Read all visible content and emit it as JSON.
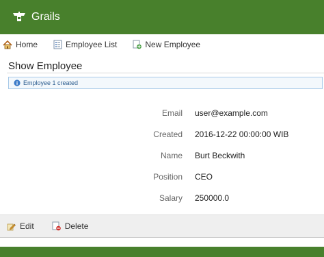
{
  "header": {
    "brand": "Grails",
    "logo_icon": "grails-logo-icon",
    "color": "#48802c"
  },
  "nav": {
    "items": [
      {
        "label": "Home",
        "icon": "home-icon"
      },
      {
        "label": "Employee List",
        "icon": "list-icon"
      },
      {
        "label": "New Employee",
        "icon": "add-document-icon"
      }
    ]
  },
  "page": {
    "title": "Show Employee"
  },
  "message": {
    "text": "Employee 1 created",
    "icon": "info-icon"
  },
  "properties": [
    {
      "label": "Email",
      "value": "user@example.com"
    },
    {
      "label": "Created",
      "value": "2016-12-22 00:00:00 WIB"
    },
    {
      "label": "Name",
      "value": "Burt Beckwith"
    },
    {
      "label": "Position",
      "value": "CEO"
    },
    {
      "label": "Salary",
      "value": "250000.0"
    }
  ],
  "buttons": {
    "edit_label": "Edit",
    "delete_label": "Delete"
  }
}
